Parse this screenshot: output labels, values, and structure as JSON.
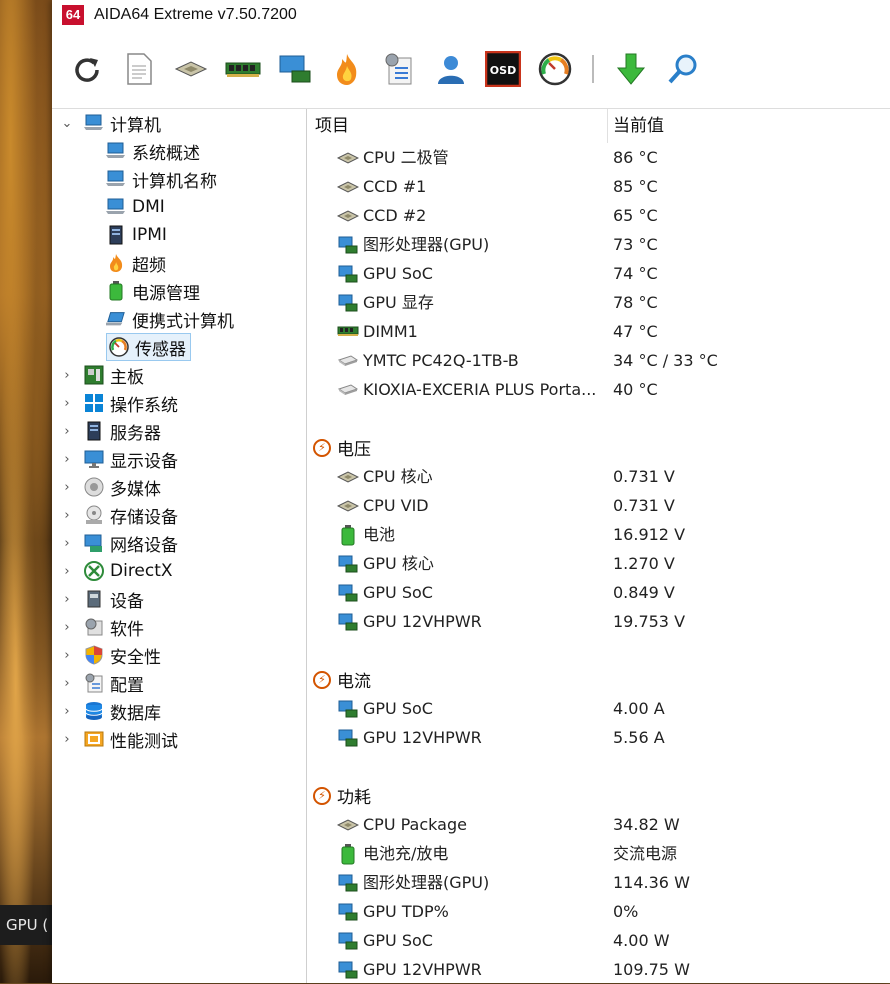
{
  "taskbar": {
    "fragment": "GPU ("
  },
  "window": {
    "logo": "64",
    "title": "AIDA64 Extreme v7.50.7200"
  },
  "toolbar": {
    "buttons": [
      "refresh-icon",
      "report-icon",
      "cpu-icon",
      "memory-icon",
      "network-icon",
      "stability-flame-icon",
      "config-checklist-icon",
      "user-icon",
      "osd-icon",
      "gauge-icon",
      "download-icon",
      "search-icon"
    ],
    "osd_label": "OSD"
  },
  "tree": {
    "root": "计算机",
    "children": [
      "系统概述",
      "计算机名称",
      "DMI",
      "IPMI",
      "超频",
      "电源管理",
      "便携式计算机",
      "传感器"
    ],
    "sections": [
      "主板",
      "操作系统",
      "服务器",
      "显示设备",
      "多媒体",
      "存储设备",
      "网络设备",
      "DirectX",
      "设备",
      "软件",
      "安全性",
      "配置",
      "数据库",
      "性能测试"
    ]
  },
  "columns": {
    "item": "项目",
    "value": "当前值"
  },
  "temperatures": [
    {
      "name": "CPU 二极管",
      "value": "86 °C",
      "icon": "cpu"
    },
    {
      "name": "CCD #1",
      "value": "85 °C",
      "icon": "cpu"
    },
    {
      "name": "CCD #2",
      "value": "65 °C",
      "icon": "cpu"
    },
    {
      "name": "图形处理器(GPU)",
      "value": "73 °C",
      "icon": "gpu"
    },
    {
      "name": "GPU SoC",
      "value": "74 °C",
      "icon": "gpu"
    },
    {
      "name": "GPU 显存",
      "value": "78 °C",
      "icon": "gpu"
    },
    {
      "name": "DIMM1",
      "value": "47 °C",
      "icon": "ram"
    },
    {
      "name": "YMTC PC42Q-1TB-B",
      "value": "34 °C / 33 °C",
      "icon": "disk"
    },
    {
      "name": "KIOXIA-EXCERIA PLUS Porta...",
      "value": "40 °C",
      "icon": "disk"
    }
  ],
  "groups": {
    "voltage": "电压",
    "current": "电流",
    "power": "功耗"
  },
  "voltages": [
    {
      "name": "CPU 核心",
      "value": "0.731 V",
      "icon": "cpu"
    },
    {
      "name": "CPU VID",
      "value": "0.731 V",
      "icon": "cpu"
    },
    {
      "name": "电池",
      "value": "16.912 V",
      "icon": "battery"
    },
    {
      "name": "GPU 核心",
      "value": "1.270 V",
      "icon": "gpu"
    },
    {
      "name": "GPU SoC",
      "value": "0.849 V",
      "icon": "gpu"
    },
    {
      "name": "GPU 12VHPWR",
      "value": "19.753 V",
      "icon": "gpu"
    }
  ],
  "currents": [
    {
      "name": "GPU SoC",
      "value": "4.00 A",
      "icon": "gpu"
    },
    {
      "name": "GPU 12VHPWR",
      "value": "5.56 A",
      "icon": "gpu"
    }
  ],
  "powers": [
    {
      "name": "CPU Package",
      "value": "34.82 W",
      "icon": "cpu"
    },
    {
      "name": "电池充/放电",
      "value": "交流电源",
      "icon": "battery"
    },
    {
      "name": "图形处理器(GPU)",
      "value": "114.36 W",
      "icon": "gpu"
    },
    {
      "name": "GPU TDP%",
      "value": "0%",
      "icon": "gpu"
    },
    {
      "name": "GPU SoC",
      "value": "4.00 W",
      "icon": "gpu"
    },
    {
      "name": "GPU 12VHPWR",
      "value": "109.75 W",
      "icon": "gpu"
    }
  ]
}
